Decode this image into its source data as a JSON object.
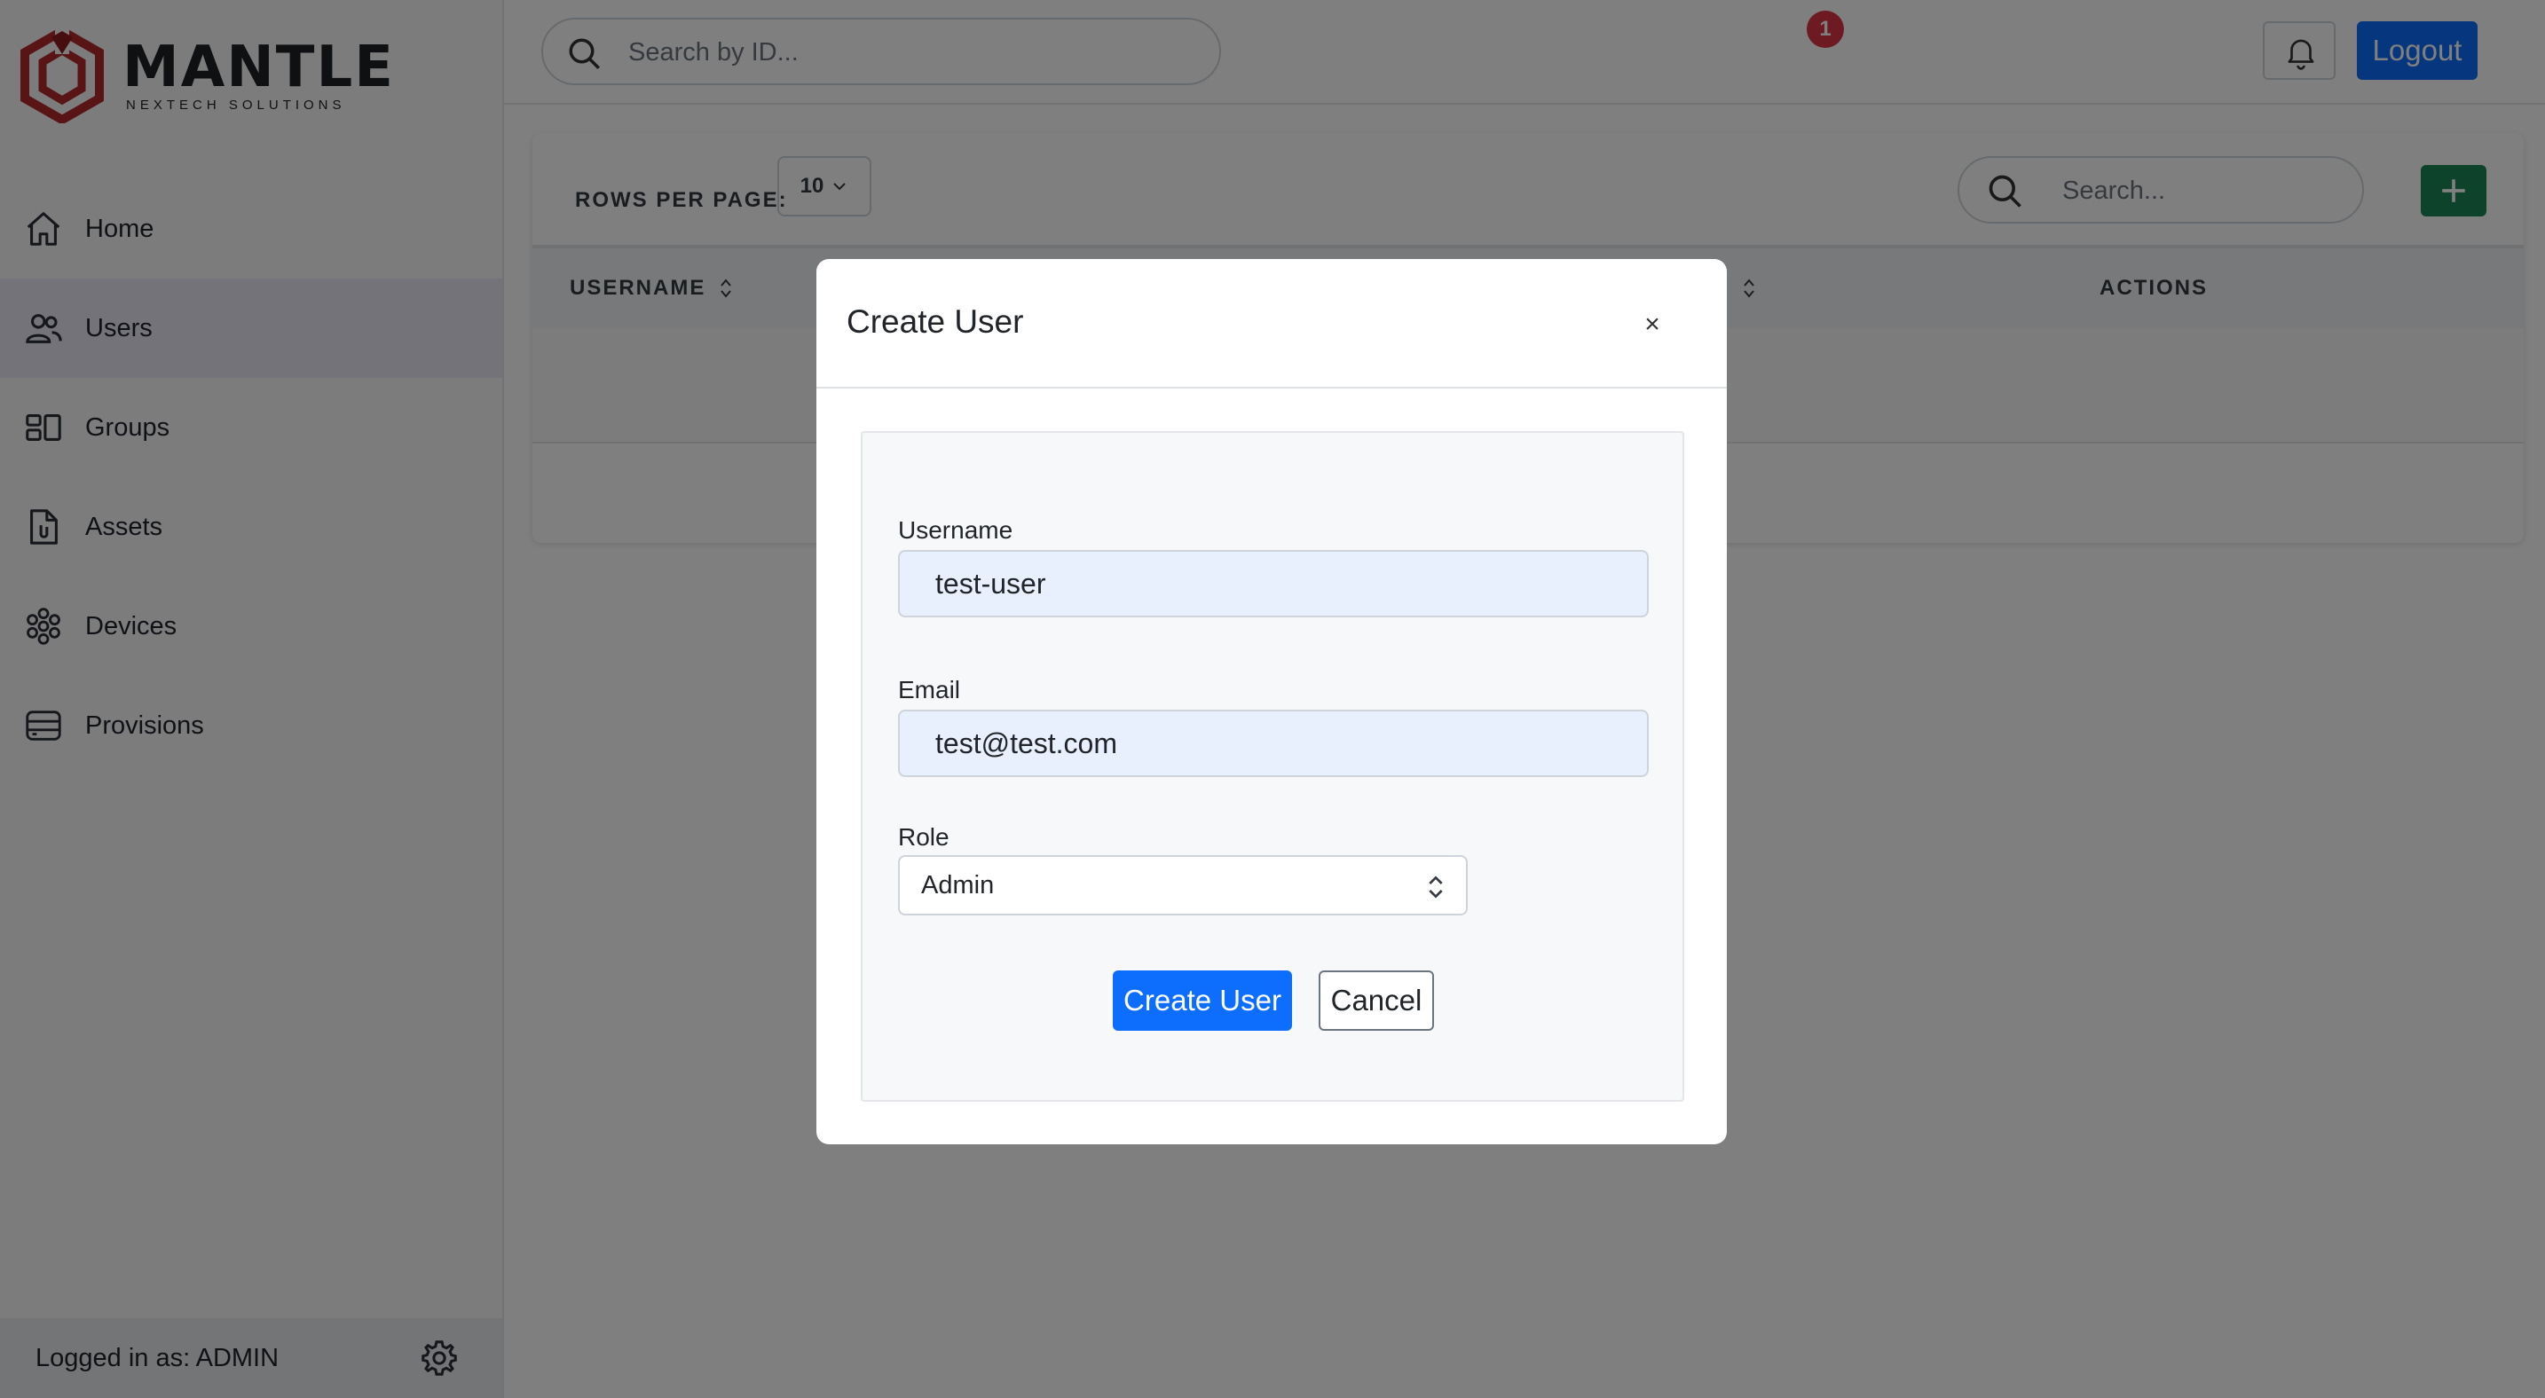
{
  "brand": {
    "name": "MANTLE",
    "tagline": "NEXTECH SOLUTIONS",
    "color": "#c0392b"
  },
  "sidebar": {
    "items": [
      {
        "label": "Home",
        "icon": "home-icon",
        "active": false
      },
      {
        "label": "Users",
        "icon": "users-icon",
        "active": true
      },
      {
        "label": "Groups",
        "icon": "groups-icon",
        "active": false
      },
      {
        "label": "Assets",
        "icon": "assets-icon",
        "active": false
      },
      {
        "label": "Devices",
        "icon": "devices-icon",
        "active": false
      },
      {
        "label": "Provisions",
        "icon": "provisions-icon",
        "active": false
      }
    ],
    "footer": {
      "logged_in_text": "Logged in as: ADMIN",
      "icon": "gear-icon"
    }
  },
  "topbar": {
    "search_placeholder": "Search by ID...",
    "notification_count": "1",
    "logout_label": "Logout"
  },
  "table": {
    "rows_per_page_label": "ROWS PER PAGE:",
    "rows_per_page_value": "10",
    "search_placeholder": "Search...",
    "columns": [
      "USERNAME",
      "ACTIONS"
    ]
  },
  "modal": {
    "title": "Create User",
    "close_label": "×",
    "fields": {
      "username_label": "Username",
      "username_value": "test-user",
      "email_label": "Email",
      "email_value": "test@test.com",
      "role_label": "Role",
      "role_value": "Admin"
    },
    "submit_label": "Create User",
    "cancel_label": "Cancel"
  },
  "colors": {
    "primary": "#0d6efd",
    "success": "#198754",
    "danger": "#dc3545",
    "sidebar_active": "#e6e7f2"
  }
}
